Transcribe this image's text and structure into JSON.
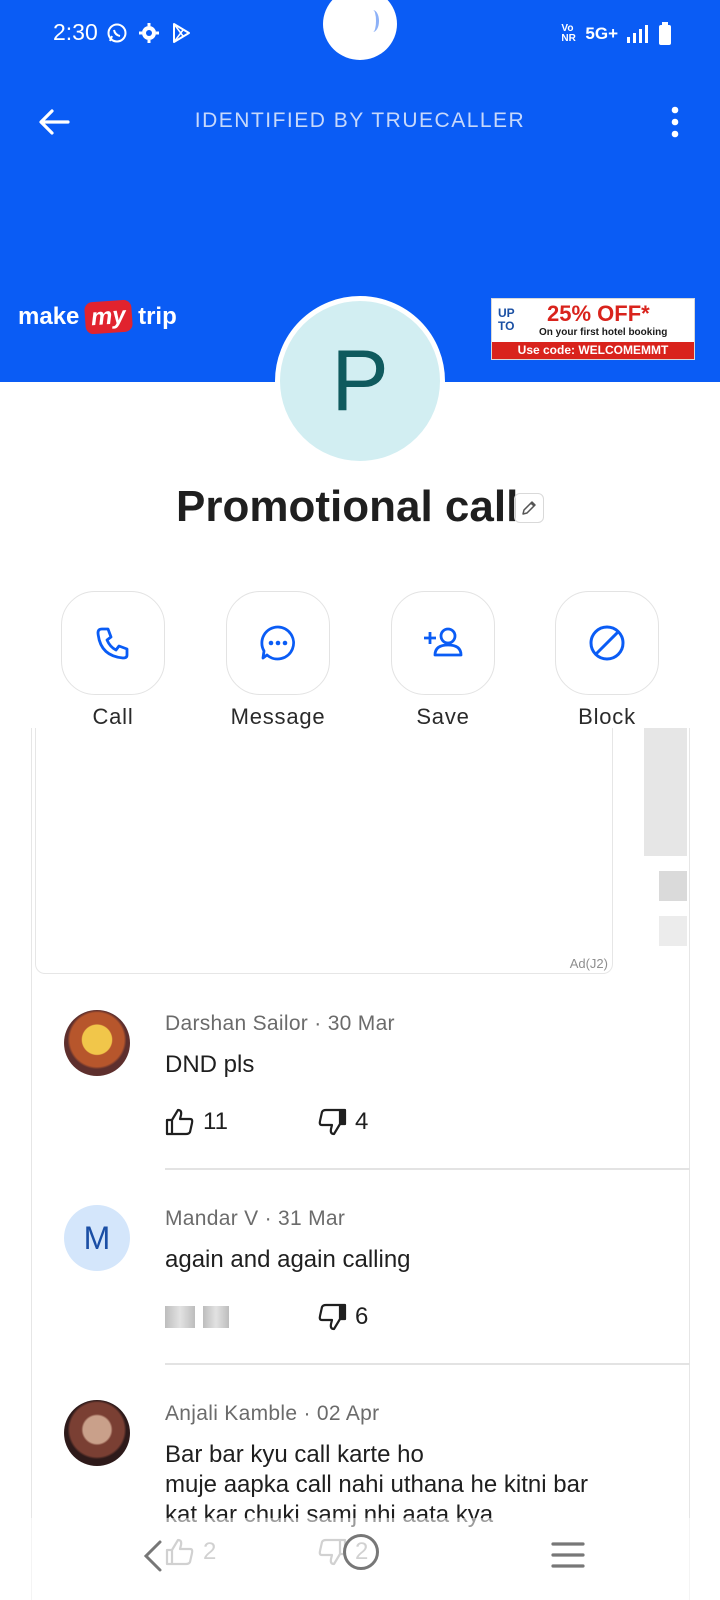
{
  "status_bar": {
    "time": "2:30",
    "volte": "Vo NR",
    "network": "5G+",
    "icons": [
      "whatsapp-icon",
      "gear-icon",
      "play-store-icon",
      "signal-icon",
      "battery-icon"
    ]
  },
  "header": {
    "title": "IDENTIFIED BY TRUECALLER",
    "accent_color": "#0a5cf5"
  },
  "banner_ad": {
    "brand_left": "make",
    "brand_mid": "my",
    "brand_right": "trip",
    "promo_upto": "UP TO",
    "promo_off": "25% OFF*",
    "promo_subtitle": "On your first hotel booking",
    "promo_code": "Use code: WELCOMEMMT"
  },
  "contact": {
    "avatar_letter": "P",
    "name": "Promotional call"
  },
  "actions": [
    {
      "label": "Call",
      "icon": "phone-icon"
    },
    {
      "label": "Message",
      "icon": "message-icon"
    },
    {
      "label": "Save",
      "icon": "add-contact-icon"
    },
    {
      "label": "Block",
      "icon": "block-icon"
    }
  ],
  "ad_card": {
    "tag": "Ad(J2)"
  },
  "comments": [
    {
      "author": "Darshan Sailor",
      "date": "30 Mar",
      "text": "DND pls",
      "likes": "11",
      "dislikes": "4"
    },
    {
      "author": "Mandar V",
      "date": "31 Mar",
      "avatar_letter": "M",
      "text": "again and again calling",
      "dislikes": "6"
    },
    {
      "author": "Anjali Kamble",
      "date": "02 Apr",
      "text_lines": [
        "Bar bar kyu call karte ho",
        "muje aapka call nahi uthana he kitni bar",
        "kat kar chuki samj nhi aata kya"
      ],
      "likes": "2",
      "dislikes": "2"
    }
  ],
  "meta_separator": "·"
}
